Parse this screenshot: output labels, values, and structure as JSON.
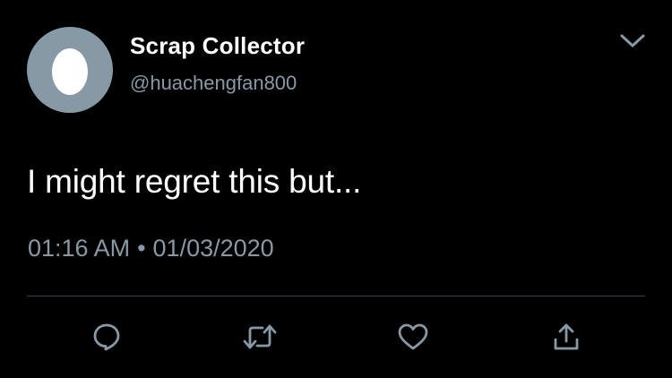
{
  "tweet": {
    "display_name": "Scrap Collector",
    "handle": "@huachengfan800",
    "text": "I might regret this but...",
    "time": "01:16 AM",
    "separator": "•",
    "date": "01/03/2020"
  },
  "header": {
    "menu_icon": "chevron-down-icon"
  },
  "actions": [
    {
      "icon": "reply-icon"
    },
    {
      "icon": "retweet-icon"
    },
    {
      "icon": "like-icon"
    },
    {
      "icon": "share-icon"
    }
  ],
  "colors": {
    "background": "#000000",
    "primary_text": "#ffffff",
    "secondary_text": "#8899a6",
    "divider": "#38444d",
    "avatar_bg": "#8899a6"
  }
}
